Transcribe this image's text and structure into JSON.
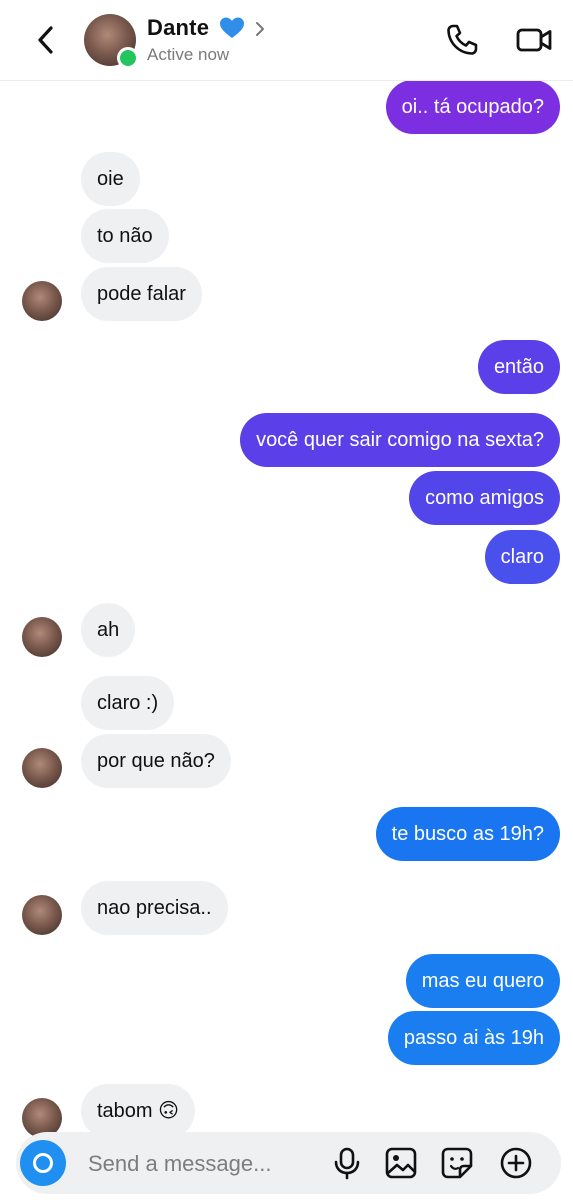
{
  "header": {
    "contact_name": "Dante",
    "status": "Active now"
  },
  "messages": [
    {
      "side": "out",
      "text": "oi.. tá ocupado?",
      "color": "#7b2fe0"
    },
    {
      "side": "in",
      "text": "oie"
    },
    {
      "side": "in",
      "text": "to não"
    },
    {
      "side": "in",
      "text": "pode falar"
    },
    {
      "side": "out",
      "text": "então",
      "color": "#5b3fe8"
    },
    {
      "side": "out",
      "text": "você quer sair comigo na sexta?",
      "color": "#5b3fe8"
    },
    {
      "side": "out",
      "text": "como amigos",
      "color": "#5246ea"
    },
    {
      "side": "out",
      "text": "claro",
      "color": "#4a50ec"
    },
    {
      "side": "in",
      "text": "ah"
    },
    {
      "side": "in",
      "text": "claro :)"
    },
    {
      "side": "in",
      "text": "por que não?"
    },
    {
      "side": "out",
      "text": "te busco as 19h?",
      "color": "#1976f0"
    },
    {
      "side": "in",
      "text": "nao precisa.."
    },
    {
      "side": "out",
      "text": "mas eu quero",
      "color": "#1a7ef0"
    },
    {
      "side": "out",
      "text": "passo ai às 19h",
      "color": "#1a7ef0"
    },
    {
      "side": "in",
      "text": "tabom 🙃"
    }
  ],
  "composer": {
    "placeholder": "Send a message..."
  },
  "icons": {
    "back": "chevron-left-icon",
    "heart": "blue-heart-icon",
    "call": "phone-icon",
    "video": "video-camera-icon",
    "camera": "camera-icon",
    "mic": "microphone-icon",
    "gallery": "image-icon",
    "sticker": "sticker-icon",
    "plus": "plus-circle-icon"
  },
  "colors": {
    "online": "#22c55e",
    "incoming_bubble": "#eff0f2",
    "camera_button": "#1f8ff2"
  }
}
